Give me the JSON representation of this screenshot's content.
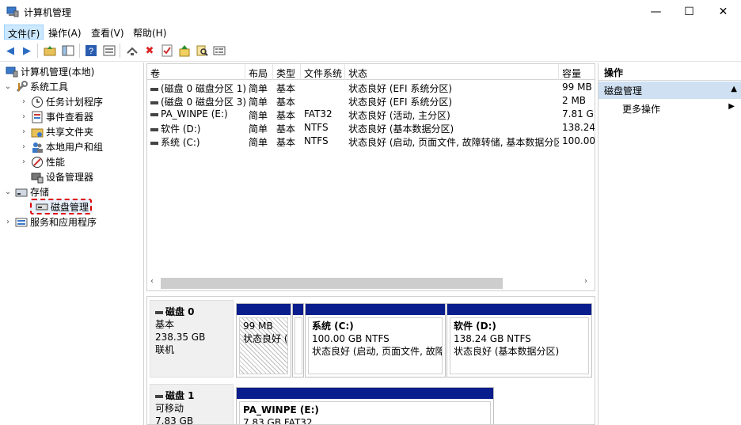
{
  "window": {
    "title": "计算机管理",
    "minimize_glyph": "—",
    "maximize_glyph": "☐",
    "close_glyph": "✕"
  },
  "menu": {
    "items": [
      "文件(F)",
      "操作(A)",
      "查看(V)",
      "帮助(H)"
    ]
  },
  "toolbar": {
    "icons": [
      "back-arrow-icon",
      "forward-arrow-icon",
      "up-folder-icon",
      "show-hide-tree-icon",
      "help-icon",
      "properties-icon",
      "connect-icon",
      "delete-icon",
      "check-icon",
      "import-icon",
      "search-icon",
      "export-list-icon"
    ]
  },
  "tree": {
    "root": "计算机管理(本地)",
    "system_tools": "系统工具",
    "task_scheduler": "任务计划程序",
    "event_viewer": "事件查看器",
    "shared_folders": "共享文件夹",
    "local_users": "本地用户和组",
    "performance": "性能",
    "device_manager": "设备管理器",
    "storage": "存储",
    "disk_management": "磁盘管理",
    "services_apps": "服务和应用程序"
  },
  "volume_list": {
    "headers": [
      "卷",
      "布局",
      "类型",
      "文件系统",
      "状态",
      "容量"
    ],
    "rows": [
      [
        "(磁盘 0 磁盘分区 1)",
        "简单",
        "基本",
        "",
        "状态良好 (EFI 系统分区)",
        "99 MB"
      ],
      [
        "(磁盘 0 磁盘分区 3)",
        "简单",
        "基本",
        "",
        "状态良好 (EFI 系统分区)",
        "2 MB"
      ],
      [
        "PA_WINPE (E:)",
        "简单",
        "基本",
        "FAT32",
        "状态良好 (活动, 主分区)",
        "7.81 GB"
      ],
      [
        "软件 (D:)",
        "简单",
        "基本",
        "NTFS",
        "状态良好 (基本数据分区)",
        "138.24"
      ],
      [
        "系统 (C:)",
        "简单",
        "基本",
        "NTFS",
        "状态良好 (启动, 页面文件, 故障转储, 基本数据分区)",
        "100.00"
      ]
    ],
    "scroll_left": "‹",
    "scroll_right": "›"
  },
  "disks": [
    {
      "name": "磁盘 0",
      "type": "基本",
      "size": "238.35 GB",
      "status": "联机",
      "partitions": [
        {
          "title": "",
          "size": "99 MB",
          "status": "状态良好 (E"
        },
        {
          "title": "",
          "size": "",
          "status": ""
        },
        {
          "title": "系统 (C:)",
          "size": "100.00 GB NTFS",
          "status": "状态良好 (启动, 页面文件, 故障"
        },
        {
          "title": "软件 (D:)",
          "size": "138.24 GB NTFS",
          "status": "状态良好 (基本数据分区)"
        }
      ]
    },
    {
      "name": "磁盘 1",
      "type": "可移动",
      "size": "7.83 GB",
      "partitions": [
        {
          "title": "PA_WINPE (E:)",
          "size": "7.83 GB FAT32"
        }
      ]
    }
  ],
  "actions": {
    "title": "操作",
    "section": "磁盘管理",
    "more": "更多操作",
    "caret_up": "▲",
    "caret_right": "▶"
  },
  "colors": {
    "partition_bar": "#0a1d8c",
    "selection_border": "#dd0000",
    "actions_section_bg": "#cfe0f2"
  }
}
